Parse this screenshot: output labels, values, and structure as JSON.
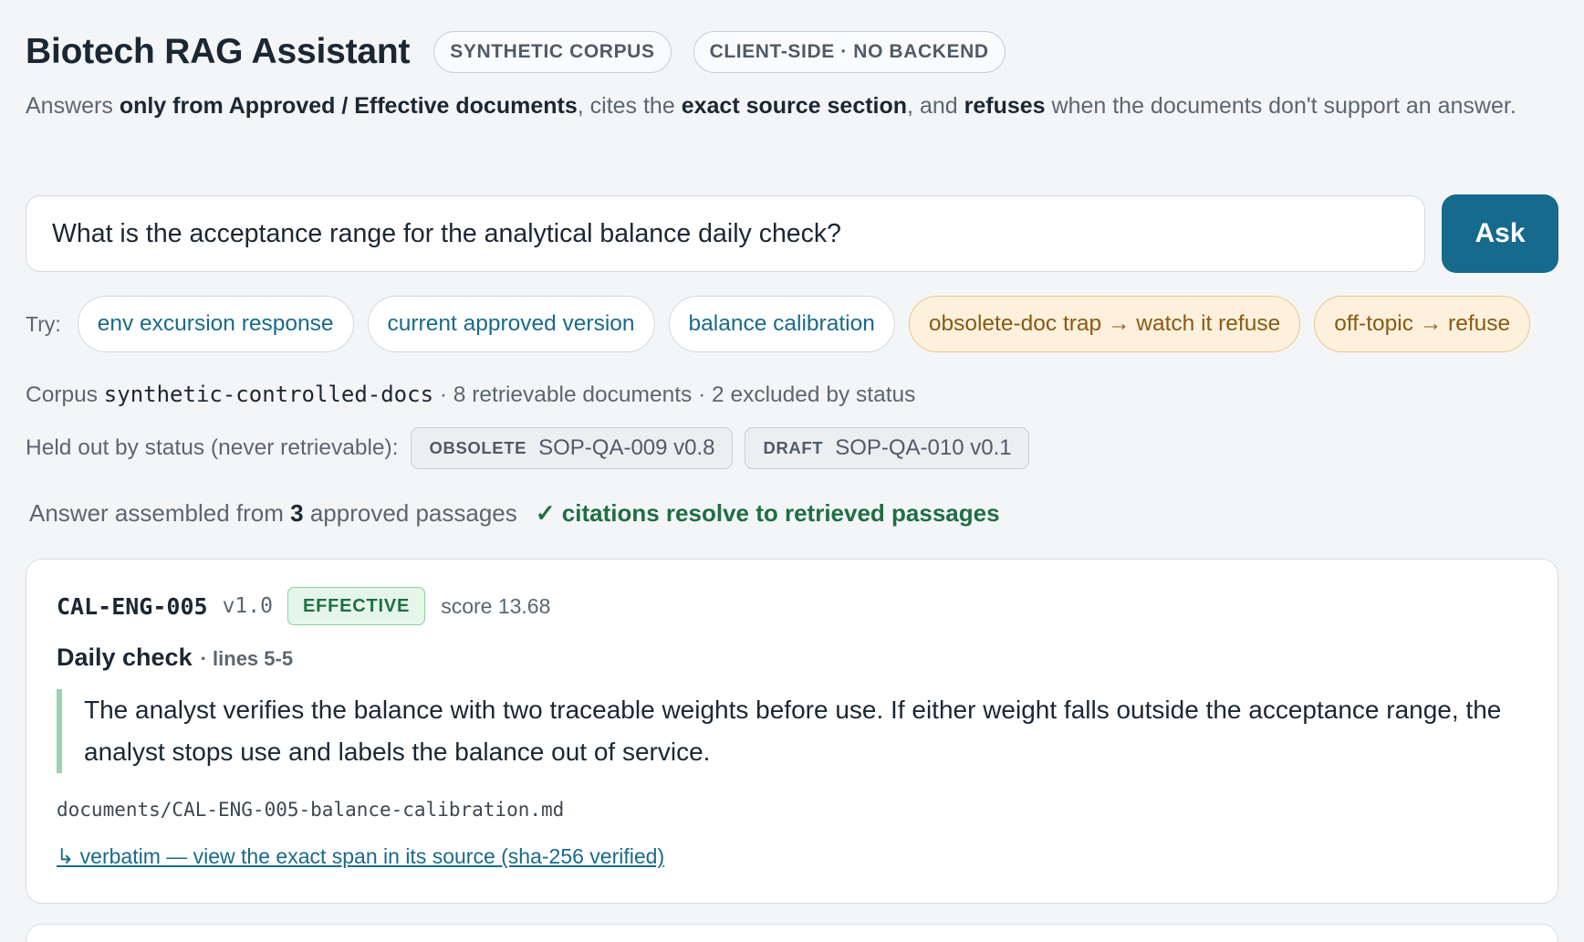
{
  "header": {
    "title": "Biotech RAG Assistant",
    "badges": [
      "SYNTHETIC CORPUS",
      "CLIENT-SIDE · NO BACKEND"
    ]
  },
  "subtitle": {
    "p1": "Answers ",
    "b1": "only from Approved / Effective documents",
    "p2": ", cites the ",
    "b2": "exact source section",
    "p3": ", and ",
    "b3": "refuses",
    "p4": " when the documents don't support an answer."
  },
  "query": {
    "value": "What is the acceptance range for the analytical balance daily check?",
    "ask_label": "Ask"
  },
  "try": {
    "label": "Try:",
    "chips": [
      "env excursion response",
      "current approved version",
      "balance calibration",
      "obsolete-doc trap → watch it refuse",
      "off-topic → refuse"
    ]
  },
  "corpus": {
    "prefix": "Corpus ",
    "name": "synthetic-controlled-docs",
    "suffix": " · 8 retrievable documents · 2 excluded by status"
  },
  "held_out": {
    "label": "Held out by status (never retrievable):",
    "items": [
      {
        "status": "OBSOLETE",
        "doc": "SOP-QA-009 v0.8"
      },
      {
        "status": "DRAFT",
        "doc": "SOP-QA-010 v0.1"
      }
    ]
  },
  "answer": {
    "prefix": "Answer assembled from ",
    "count": "3",
    "suffix": " approved passages",
    "check": "✓ citations resolve to retrieved passages"
  },
  "passages": [
    {
      "doc_id": "CAL-ENG-005",
      "version": "v1.0",
      "status": "EFFECTIVE",
      "score": "score 13.68",
      "section": "Daily check",
      "lines": "· lines 5-5",
      "text": "The analyst verifies the balance with two traceable weights before use. If either weight falls outside the acceptance range, the analyst stops use and labels the balance out of service.",
      "path": "documents/CAL-ENG-005-balance-calibration.md",
      "link": "↳ verbatim — view the exact span in its source (sha-256 verified)"
    }
  ],
  "colors": {
    "accent": "#166a8c",
    "link": "#1a6a8a",
    "success": "#1f6f43",
    "warn_chip_bg": "#fdf1dd"
  }
}
